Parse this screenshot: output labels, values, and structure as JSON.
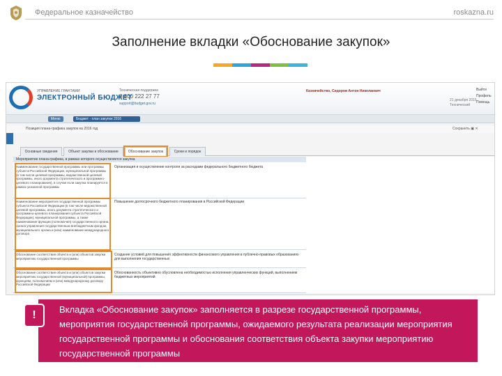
{
  "header": {
    "org": "Федеральное казначейство",
    "site": "roskazna.ru",
    "title": "Заполнение вкладки «Обоснование закупок»",
    "stripe_colors": [
      "#f7a823",
      "#2aa6d8",
      "#b6287f",
      "#7fbf3f",
      "#3ab5d9"
    ]
  },
  "app": {
    "logo_small": "УПРАВЛЕНИЕ ГРАНТАМИ",
    "logo_text": "ЭЛЕКТРОННЫЙ БЮДЖЕТ",
    "support_label": "Техническая поддержка",
    "support_phone": "8 800 222 27 77",
    "support_mail": "support@budget.gov.ru",
    "user_name": "Казначейство, Сидоров Антон Николаевич",
    "user_info1": "21 декабря 2015",
    "user_info2": "Технический",
    "head_buttons": [
      "Выйти",
      "Профиль",
      "Помощь"
    ],
    "nav_home": "Меню",
    "nav_tab": "Бюджет - план закупок 2016",
    "crumb": "Позиция плана-графика закупок на 2016 год",
    "right_icons": "Сохранить ▣ ✕",
    "tabs": [
      "Основные сведения",
      "Объект закупки и обоснование",
      "Обоснование закупок",
      "Сроки и порядок исполнения"
    ],
    "table_header": "Мероприятие плана-графика, в рамках которого осуществляется закупка"
  },
  "rows": [
    {
      "left": "Наименование государственной программы или программы субъекта Российской Федерации, муниципальной программы (в том числе целевой программы, ведомственной целевой программы, иного документа стратегического и программно-целевого планирования), в случае если закупка планируется в рамках указанной программы",
      "right": "Организация и осуществление контроля за расходами федерального бюджетного бюджета"
    },
    {
      "left": "Наименование мероприятия государственной программы субъекта Российской Федерации (в том числе ведомственной целевой программы, иного документа стратегического и программно-целевого планирования субъекта Российской Федерации), муниципальной программы, а также наименование функции (полномочия) государственного органа, органа управления государственным внебюджетным фондом, муниципального органа и (или) наименование международного договора",
      "right": "Повышение долгосрочного бюджетного планирования в Российской Федерации"
    },
    {
      "left": "Обоснование соответствия объекта и (или) объектов закупки мероприятию государственной программы",
      "right": "Создание условий для повышения эффективности финансового управления в публично-правовых образованиях для выполнения государственных"
    },
    {
      "left": "Обоснование соответствия объекта и (или) объектов закупки мероприятию государственной (муниципальной) программы, функциям, полномочиям и (или) международному договору Российской Федерации",
      "right": "Обоснованность объективно обусловлена необходимостью исполнения управленческих функций, выполнением бюджетных мероприятий"
    }
  ],
  "callout": {
    "mark": "!",
    "text": "Вкладка «Обоснование закупок» заполняется в разрезе государственной программы, мероприятия государственной программы, ожидаемого результата реализации мероприятия государственной программы и обоснования соответствия объекта закупки мероприятию государственной программы",
    "color": "#c2175b"
  }
}
